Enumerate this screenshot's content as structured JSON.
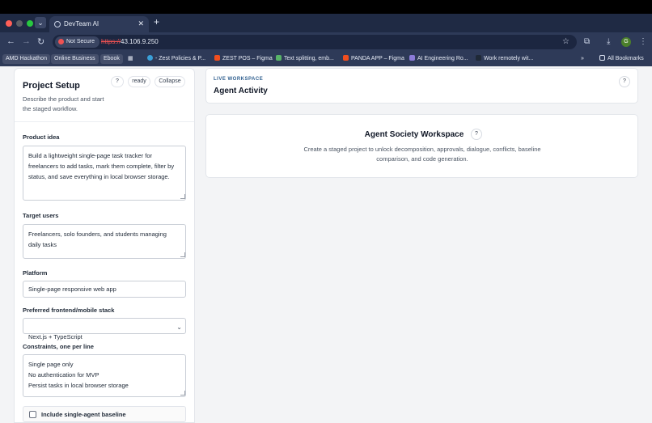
{
  "browser": {
    "tab_title": "DevTeam AI",
    "new_tab_glyph": "+",
    "close_glyph": "✕",
    "security_label": "Not Secure",
    "url_scheme": "https://",
    "url_host": "43.106.9.250",
    "profile_initial": "G",
    "bookmarks": [
      "AMD Hackathon",
      "Online Business",
      "Ebook",
      "- Zest Policies & P...",
      "ZEST POS – Figma",
      "Text splitting, emb...",
      "PANDA APP – Figma",
      "AI Engineering Ro...",
      "Work remotely wit..."
    ],
    "bookmarks_overflow": "»",
    "all_bookmarks": "All Bookmarks"
  },
  "sidebar": {
    "title": "Project Setup",
    "description": "Describe the product and start the staged workflow.",
    "help": "?",
    "status": "ready",
    "collapse": "Collapse",
    "product_idea_label": "Product idea",
    "product_idea_value": "Build a lightweight single-page task tracker for freelancers to add tasks, mark them complete, filter by status, and save everything in local browser storage.",
    "target_users_label": "Target users",
    "target_users_value": "Freelancers, solo founders, and students managing daily tasks",
    "platform_label": "Platform",
    "platform_value": "Single-page responsive web app",
    "stack_label": "Preferred frontend/mobile stack",
    "stack_value": "Next.js + TypeScript",
    "constraints_label": "Constraints, one per line",
    "constraints_value": "Single page only\nNo authentication for MVP\nPersist tasks in local browser storage",
    "baseline_label": "Include single-agent baseline"
  },
  "activity": {
    "eyebrow": "LIVE WORKSPACE",
    "title": "Agent Activity",
    "help": "?"
  },
  "workspace": {
    "title": "Agent Society Workspace",
    "help": "?",
    "description": "Create a staged project to unlock decomposition, approvals, dialogue, conflicts, baseline comparison, and code generation."
  },
  "colors": {
    "chrome": "#2e3a58",
    "accent": "#2f5f8f",
    "not_secure": "#f05252"
  }
}
